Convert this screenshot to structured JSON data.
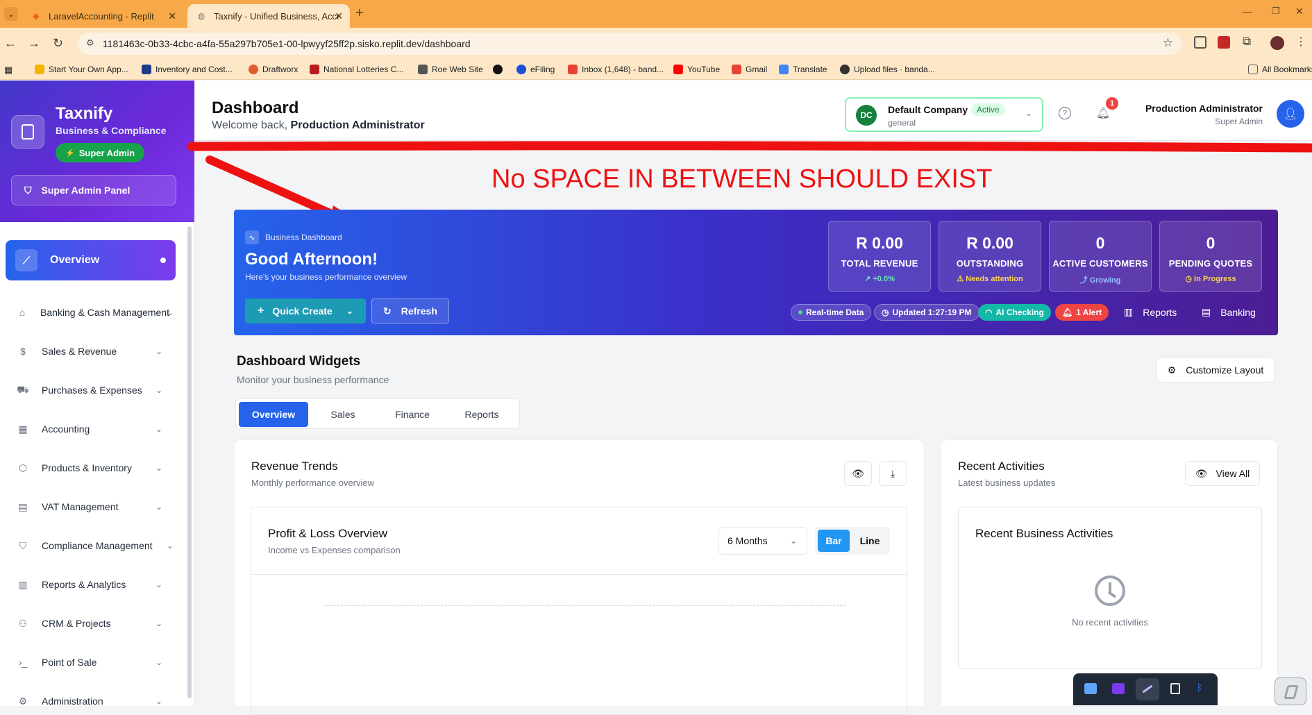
{
  "browser": {
    "tabs": [
      {
        "title": "LaravelAccounting - Replit",
        "active": false
      },
      {
        "title": "Taxnify - Unified Business, Acco",
        "active": true
      }
    ],
    "url": "1181463c-0b33-4cbc-a4fa-55a297b705e1-00-lpwyyf25ff2p.sisko.replit.dev/dashboard",
    "bookmarks": [
      "Start Your Own App...",
      "Inventory and Cost...",
      "Draftworx",
      "National Lotteries C...",
      "Roe Web Site",
      "eFiling",
      "Inbox (1,648) - band...",
      "YouTube",
      "Gmail",
      "Translate",
      "Upload files · banda..."
    ],
    "all_bookmarks": "All Bookmarks"
  },
  "sidebar": {
    "brand_name": "Taxnify",
    "brand_tagline": "Business & Compliance",
    "role_badge": "Super Admin",
    "admin_panel": "Super Admin Panel",
    "overview": "Overview",
    "items": [
      {
        "label": "Banking & Cash Management",
        "icon": "bank-icon"
      },
      {
        "label": "Sales & Revenue",
        "icon": "dollar-icon"
      },
      {
        "label": "Purchases & Expenses",
        "icon": "truck-icon"
      },
      {
        "label": "Accounting",
        "icon": "calculator-icon"
      },
      {
        "label": "Products & Inventory",
        "icon": "box-icon"
      },
      {
        "label": "VAT Management",
        "icon": "receipt-icon"
      },
      {
        "label": "Compliance Management",
        "icon": "shield-icon"
      },
      {
        "label": "Reports & Analytics",
        "icon": "bar-chart-icon"
      },
      {
        "label": "CRM & Projects",
        "icon": "users-icon"
      },
      {
        "label": "Point of Sale",
        "icon": "terminal-icon"
      },
      {
        "label": "Administration",
        "icon": "gear-icon"
      }
    ]
  },
  "header": {
    "title": "Dashboard",
    "welcome_prefix": "Welcome back, ",
    "welcome_name": "Production Administrator",
    "company_initials": "DC",
    "company_name": "Default Company",
    "company_status": "Active",
    "company_type": "general",
    "notification_count": "1",
    "user_name": "Production Administrator",
    "user_role": "Super Admin"
  },
  "annotation": {
    "text": "No SPACE IN BETWEEN SHOULD EXIST",
    "color": "#ee1111"
  },
  "hero": {
    "eyebrow": "Business Dashboard",
    "greeting": "Good Afternoon!",
    "subtitle": "Here's your business performance overview",
    "quick_create": "Quick Create",
    "refresh": "Refresh",
    "stats": [
      {
        "value": "R 0.00",
        "label": "TOTAL REVENUE",
        "sub": "↗ +0.0%",
        "sub_color": "#6ee7b7"
      },
      {
        "value": "R 0.00",
        "label": "OUTSTANDING",
        "sub": "⚠ Needs attention",
        "sub_color": "#fcd34d"
      },
      {
        "value": "0",
        "label": "ACTIVE CUSTOMERS",
        "sub": "⤴ Growing",
        "sub_color": "#93c5fd"
      },
      {
        "value": "0",
        "label": "PENDING QUOTES",
        "sub": "◷ In Progress",
        "sub_color": "#fcd34d"
      }
    ],
    "pills": [
      "Real-time Data",
      "Updated 1:27:19 PM",
      "AI Checking",
      "1 Alert"
    ],
    "links": [
      "Reports",
      "Banking"
    ]
  },
  "widgets": {
    "title": "Dashboard Widgets",
    "subtitle": "Monitor your business performance",
    "customize": "Customize Layout",
    "tabs": [
      "Overview",
      "Sales",
      "Finance",
      "Reports"
    ]
  },
  "revenue": {
    "title": "Revenue Trends",
    "subtitle": "Monthly performance overview",
    "pl_title": "Profit & Loss Overview",
    "pl_subtitle": "Income vs Expenses comparison",
    "period": "6 Months",
    "toggle": [
      "Bar",
      "Line"
    ]
  },
  "activities": {
    "title": "Recent Activities",
    "subtitle": "Latest business updates",
    "view_all": "View All",
    "inner_title": "Recent Business Activities",
    "empty": "No recent activities"
  }
}
